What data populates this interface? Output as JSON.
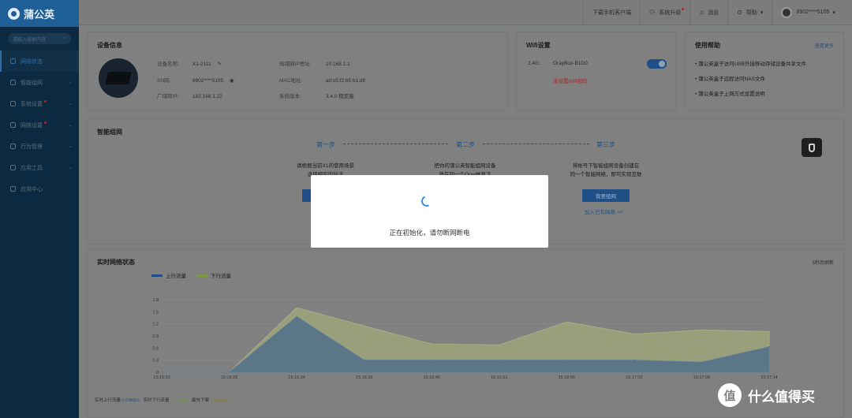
{
  "app": {
    "name": "蒲公英"
  },
  "sidebar": {
    "search_placeholder": "请输入搜索内容",
    "items": [
      {
        "label": "网络状态",
        "active": true
      },
      {
        "label": "智能组网"
      },
      {
        "label": "系统设置",
        "badge": true
      },
      {
        "label": "网络设置",
        "badge": true
      },
      {
        "label": "行为管理"
      },
      {
        "label": "应用工具"
      },
      {
        "label": "应用中心"
      }
    ]
  },
  "topbar": {
    "download_client": "下载手机客户端",
    "system_upgrade": "系统升级",
    "messages": "消息",
    "help": "帮助",
    "user": "8902****5105"
  },
  "device_info": {
    "title": "设备信息",
    "name_label": "设备名称:",
    "name_value": "X1-2111",
    "sn_label": "SN码:",
    "sn_value": "8902****5105",
    "wan_ip_label": "广域网IP:",
    "wan_ip_value": "192.168.1.22",
    "lan_ip_label": "局域网IP地址:",
    "lan_ip_value": "10.168.1.1",
    "mac_label": "MAC地址:",
    "mac_value": "a0:c5:f2:b5:b1:d0",
    "version_label": "系统版本:",
    "version_value": "3.4.0 稳定版"
  },
  "wifi": {
    "title": "Wifi设置",
    "band": "2.4G:",
    "ssid": "OrayBox-B1D0",
    "warning": "未设置Wifi密码",
    "enabled": true
  },
  "help": {
    "title": "使用帮助",
    "more": "查看更多",
    "items": [
      "蒲公英盒子访问USB外接移动存储设备共享文件",
      "蒲公英盒子远程访问NAS文件",
      "蒲公英盒子上网方式设置说明"
    ]
  },
  "smart_network": {
    "title": "智能组网",
    "step1": {
      "label": "第一步",
      "line1": "请根据当前X1的使用场景",
      "line2": "选择相应的玩法"
    },
    "step2": {
      "label": "第二步",
      "line1": "把你的蒲公英智能组网设备",
      "line2": "放在同一个Oray帐号下"
    },
    "step3": {
      "label": "第三步",
      "line1": "将帐号下智能组网设备创建在",
      "line2": "同一个智能网络，即可实现互联",
      "button": "我要组网",
      "link": "加入已有网络 >>"
    }
  },
  "realtime": {
    "title": "实时网络状态",
    "refresh_note": "5秒后刷新",
    "legend_up": "上行流量",
    "legend_down": "下行流量",
    "stat_up_label": "实时上行流量",
    "stat_up_value": "0.63KB/s",
    "stat_down_label": "实时下行流量",
    "stat_down_value": "1.01KB/s",
    "stat_max_label": "最快下载",
    "stat_max_value": "1.92KB/s"
  },
  "modal": {
    "text": "正在初始化，请勿断网断电"
  },
  "watermark": {
    "text": "什么值得买",
    "logo": "值"
  },
  "colors": {
    "upload": "#1e4f86",
    "download": "#7a9a3a",
    "accent": "#3d8ee8",
    "warning": "#a0282a"
  },
  "chart_data": {
    "type": "area",
    "x": [
      "15:16:23",
      "15:16:28",
      "15:16:34",
      "15:16:39",
      "15:16:45",
      "15:16:51",
      "15:16:56",
      "15:17:02",
      "15:17:08",
      "15:17:14"
    ],
    "ylim": [
      0,
      1.8
    ],
    "yticks": [
      "0",
      "0.3",
      "0.6",
      "0.9",
      "1.2",
      "1.5",
      "1.8"
    ],
    "series": [
      {
        "name": "上行流量",
        "values": [
          0,
          0,
          1.38,
          0.3,
          0.3,
          0.3,
          0.3,
          0.3,
          0.25,
          0.63
        ],
        "color": "#1e4f86"
      },
      {
        "name": "下行流量",
        "values": [
          0,
          0,
          1.6,
          1.15,
          0.7,
          0.68,
          1.25,
          0.95,
          1.05,
          1.01
        ],
        "color": "#7a9a3a"
      }
    ]
  }
}
